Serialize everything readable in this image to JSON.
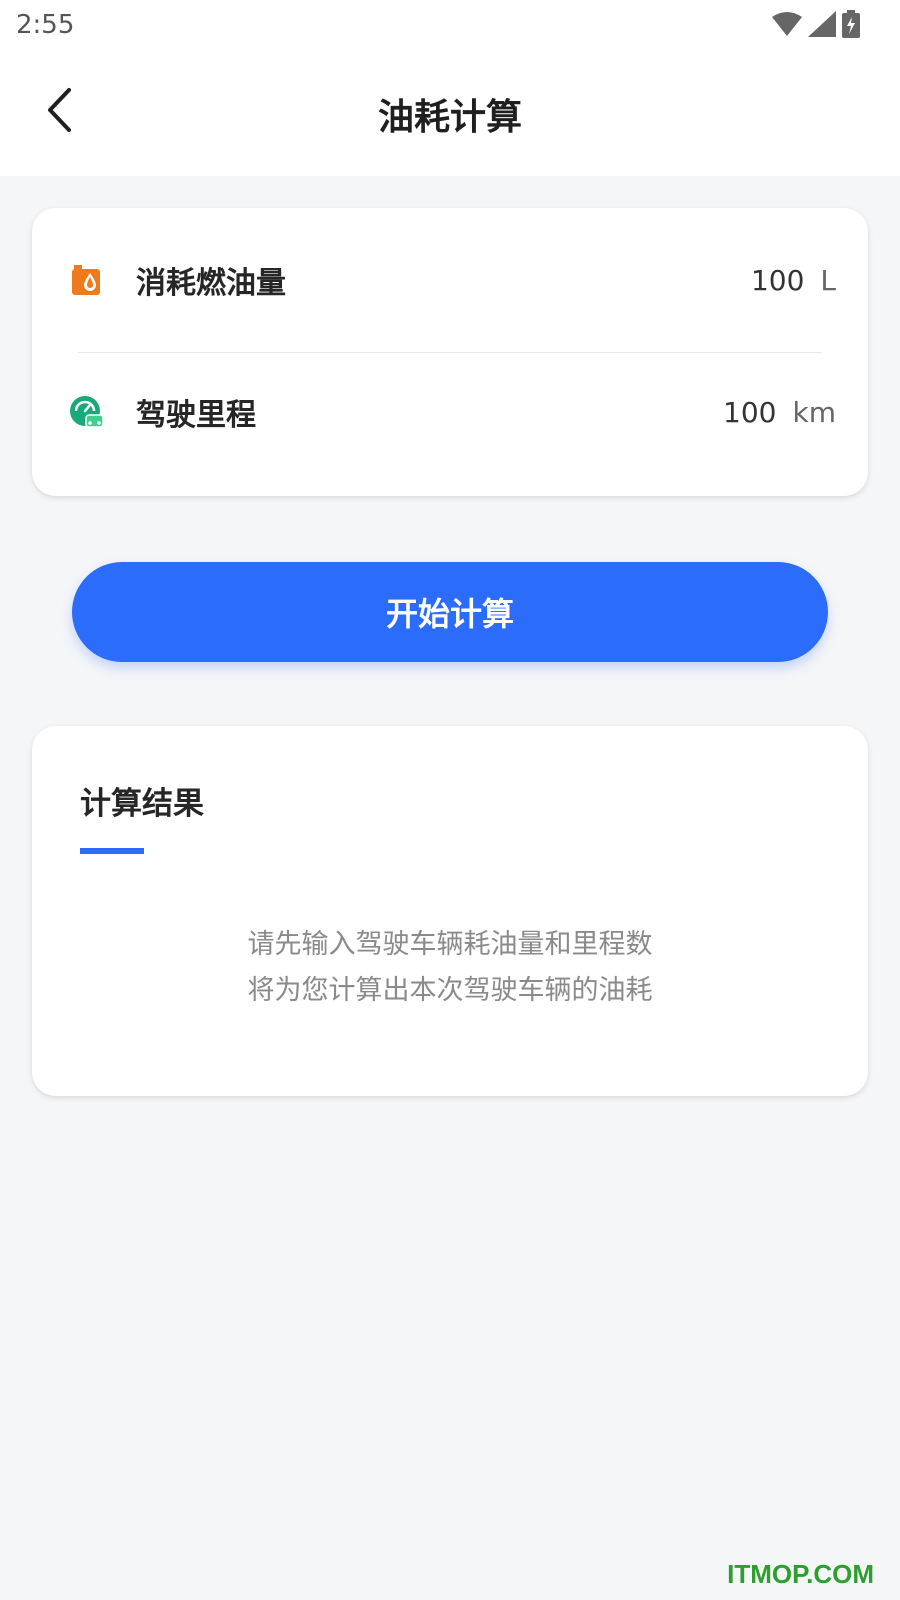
{
  "status_bar": {
    "time": "2:55"
  },
  "nav": {
    "title": "油耗计算"
  },
  "inputs": {
    "fuel": {
      "label": "消耗燃油量",
      "value": "100",
      "unit": "L",
      "icon_color": "#f07a1a"
    },
    "distance": {
      "label": "驾驶里程",
      "value": "100",
      "unit": "km",
      "icon_color": "#1aa97a"
    }
  },
  "action": {
    "calculate_label": "开始计算",
    "color": "#2c6cfb"
  },
  "result": {
    "title": "计算结果",
    "hint_line1": "请先输入驾驶车辆耗油量和里程数",
    "hint_line2": "将为您计算出本次驾驶车辆的油耗"
  },
  "watermark": {
    "text": "ITMOP.COM"
  }
}
